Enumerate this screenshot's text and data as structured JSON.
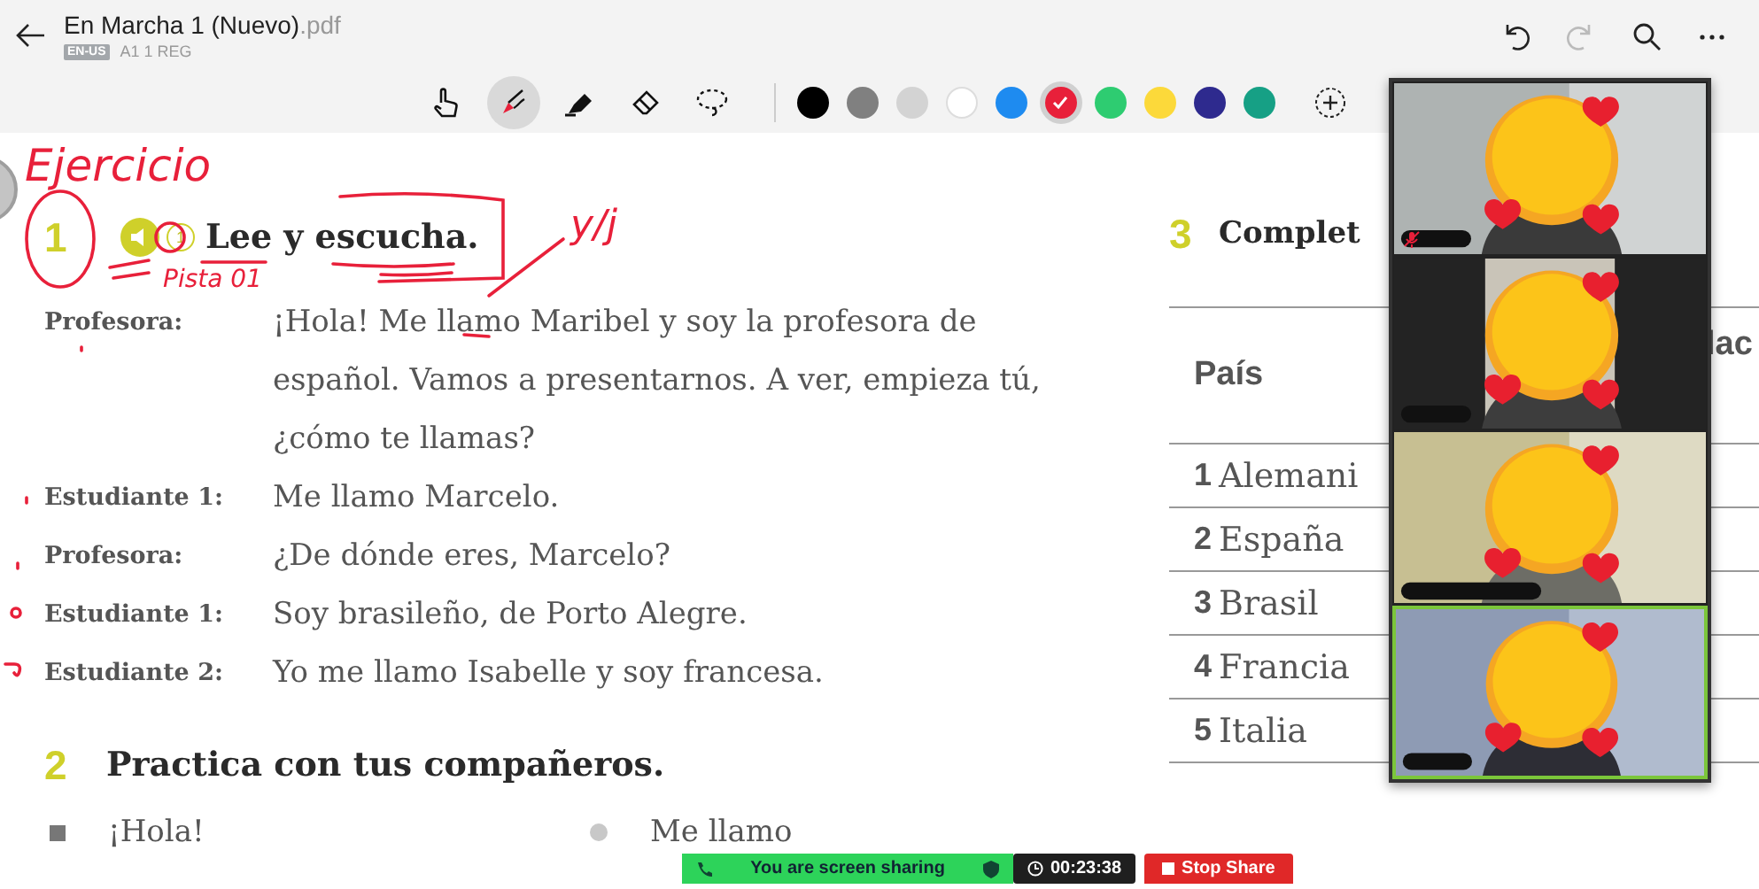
{
  "header": {
    "title": "En Marcha 1 (Nuevo)",
    "extension": ".pdf",
    "language_badge": "EN-US",
    "subtitle": "A1 1 REG"
  },
  "tools": [
    {
      "kind": "touch",
      "selected": false
    },
    {
      "kind": "pen",
      "selected": true
    },
    {
      "kind": "highlighter",
      "selected": false
    },
    {
      "kind": "eraser",
      "selected": false
    },
    {
      "kind": "lasso",
      "selected": false
    }
  ],
  "colors": [
    {
      "color": "#000000",
      "selected": false
    },
    {
      "color": "#808080",
      "selected": false
    },
    {
      "color": "#d3d3d3",
      "selected": false
    },
    {
      "color": "#ffffff",
      "selected": false
    },
    {
      "color": "#1e8bf0",
      "selected": false
    },
    {
      "color": "#e8203a",
      "selected": true
    },
    {
      "color": "#2ecc71",
      "selected": false
    },
    {
      "color": "#fcd93a",
      "selected": false
    },
    {
      "color": "#2e2a8e",
      "selected": false
    },
    {
      "color": "#16a085",
      "selected": false
    }
  ],
  "exercise_1": {
    "number": "1",
    "track": "1",
    "title": "Lee y escucha.",
    "dialogue": [
      {
        "speaker": "Profesora:",
        "text": "¡Hola! Me llamo Maribel y soy la profesora de español. Vamos a presentarnos. A ver, empieza tú, ¿cómo te llamas?"
      },
      {
        "speaker": "Estudiante 1:",
        "text": "Me llamo Marcelo."
      },
      {
        "speaker": "Profesora:",
        "text": "¿De dónde eres, Marcelo?"
      },
      {
        "speaker": "Estudiante 1:",
        "text": "Soy brasileño, de Porto Alegre."
      },
      {
        "speaker": "Estudiante 2:",
        "text": "Yo me llamo Isabelle y soy francesa."
      }
    ]
  },
  "exercise_2": {
    "number": "2",
    "title": "Practica con tus compañeros.",
    "bullets": [
      {
        "kind": "square",
        "text": "¡Hola!"
      },
      {
        "kind": "circle",
        "text": "Me llamo"
      }
    ]
  },
  "exercise_3": {
    "number": "3",
    "title": "Complet",
    "table": {
      "columns": [
        "País",
        "lac"
      ],
      "rows": [
        {
          "number": "1",
          "country": "Alemani"
        },
        {
          "number": "2",
          "country": "España"
        },
        {
          "number": "3",
          "country": "Brasil"
        },
        {
          "number": "4",
          "country": "Francia"
        },
        {
          "number": "5",
          "country": "Italia"
        }
      ]
    }
  },
  "annotations": [
    {
      "kind": "heading",
      "text": "Ejercicio"
    },
    {
      "kind": "track",
      "text": "Pista 01"
    },
    {
      "kind": "note",
      "text": "y/j"
    }
  ],
  "video_tiles": [
    {
      "kind": "picture",
      "muted": true,
      "speaking": false
    },
    {
      "kind": "picture",
      "muted": false,
      "speaking": false
    },
    {
      "kind": "picture",
      "muted": false,
      "speaking": false
    },
    {
      "kind": "picture",
      "muted": false,
      "speaking": true
    }
  ],
  "share_bar": {
    "status": "You are screen sharing",
    "timer": "00:23:38",
    "stop_button": "Stop Share"
  }
}
